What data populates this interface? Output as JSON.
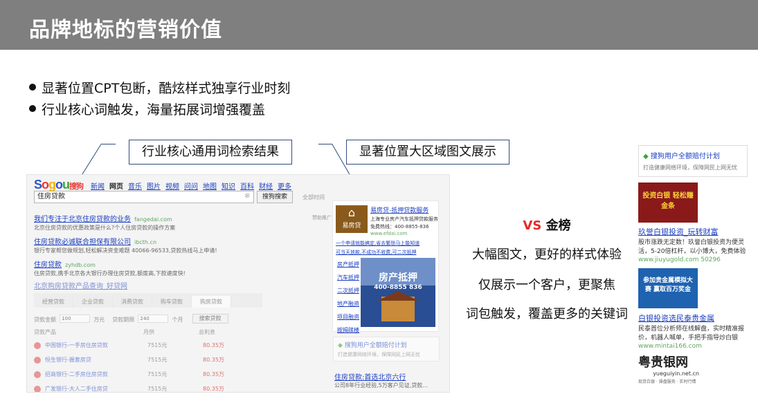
{
  "header": {
    "title": "品牌地标的营销价值"
  },
  "bullets": [
    "显著位置CPT包断，酷炫样式独享行业时刻",
    "行业核心词触发，海量拓展词增强覆盖"
  ],
  "callouts": {
    "left": "行业核心通用词检索结果",
    "right": "显著位置大区域图文展示"
  },
  "serp": {
    "logo_text": "Sogou搜狗",
    "nav": [
      "新闻",
      "网页",
      "音乐",
      "图片",
      "视频",
      "问问",
      "地图",
      "知识",
      "百科",
      "财经",
      "更多"
    ],
    "query": "住房贷款",
    "search_button": "搜狗搜索",
    "settings_link": "全部时间",
    "promo_tag": "赞助推广",
    "results": [
      {
        "title": "我们专注于北京住房贷款的业务",
        "url": "fangedai.com",
        "desc": "北京住房贷款的优惠政策是什么?个人住房贷款的操作方案"
      },
      {
        "title": "住房贷款必诚联合担保有限公司",
        "url": "ibcth.cn",
        "desc": "银行专家帮您做规划,轻松解决资金难题 40066-96533,贷款热线马上申请!"
      },
      {
        "title": "住房贷款",
        "url": "zyhdb.com",
        "desc": "住房贷款,携手北京各大银行办理住房贷款,额度高,下款速度快!"
      }
    ],
    "loan_widget": {
      "title": "北京购房贷款产品查询_好贷网",
      "tabs": [
        "经营贷款",
        "企业贷款",
        "消费贷款",
        "购车贷款",
        "购房贷款"
      ],
      "amount_label": "贷款金额",
      "amount_value": "100",
      "amount_unit": "万元",
      "term_label": "贷款期限",
      "term_value": "240",
      "term_unit": "个月",
      "search_button": "搜索贷款",
      "columns": [
        "贷款产品",
        "月供",
        "总利息"
      ],
      "rows": [
        {
          "bank": "中国银行-一手房住房贷款",
          "monthly": "7515元",
          "interest": "80.35万"
        },
        {
          "bank": "恒生银行-握套房贷",
          "monthly": "7515元",
          "interest": "80.35万"
        },
        {
          "bank": "招商银行-二手房住房贷款",
          "monthly": "7515元",
          "interest": "80.35万"
        },
        {
          "bank": "广发银行-大人二手住房贷",
          "monthly": "7515元",
          "interest": "80.35万"
        }
      ]
    },
    "ad": {
      "brand_name": "易房贷",
      "title": "易房贷-抵押贷款服务",
      "desc": "上海专业房产汽车抵押贷款服务",
      "phone": "免费热线：400-8855-836",
      "url": "www.efdai.com",
      "links": [
        "一个申请就能搞定,省去繁琐马上能知道",
        "可当天放款,不成功不收费,可二次抵押"
      ],
      "side_links": [
        "房产抵押",
        "汽车抵押",
        "二次抵押",
        "地产融资",
        "项目融资",
        "按揭赎楼"
      ],
      "image_title": "房产抵押",
      "image_phone": "400-8855 836"
    },
    "guarantee": {
      "title": "搜狗用户全额赔付计划",
      "desc": "打造健康网络环境，保障网民上网无忧"
    },
    "bottom_result": {
      "title": "住房贷款:首选北京六行",
      "desc": "公司8年行业经验,5万客户见证,贷款..."
    }
  },
  "middle": {
    "vs": "VS",
    "vs_title": "金榜",
    "lines": [
      "大幅图文，更好的样式体验",
      "仅展示一个客户，更聚焦",
      "词包触发，覆盖更多的关键词"
    ]
  },
  "right": {
    "guarantee": {
      "title": "搜狗用户全额赔付计划",
      "desc": "打造健康网络环境，保障网民上网无忧"
    },
    "ad1": {
      "image_text": "投资白银 轻松赚金条",
      "title": "玖誉白银投资_玩转财富",
      "desc": "股市涨跌无定数！玖誉白银投资为便灵活，5-20倍杠杆，以小博大，免费体验",
      "url": "www.jiuyugold.com 50296"
    },
    "ad2": {
      "image_text": "参加贵金属模拟大赛 赢取百万奖金",
      "title": "白银投资选民泰贵金属",
      "desc": "民泰首位分析师在线解盘，实时精准报价，机器人喊单，手把手指导炒白银",
      "url": "www.mintai166.com"
    },
    "ad3": {
      "brand": "粤贵银网",
      "sub": "yueguiyin.net.cn",
      "tag": "现货白银 · 操盘服务 · 实时行情"
    }
  },
  "colors": {
    "header": "#7f7f7f",
    "callout_border": "#2f4b7c",
    "link": "#1a3dc1",
    "vs": "#e52a2a"
  }
}
